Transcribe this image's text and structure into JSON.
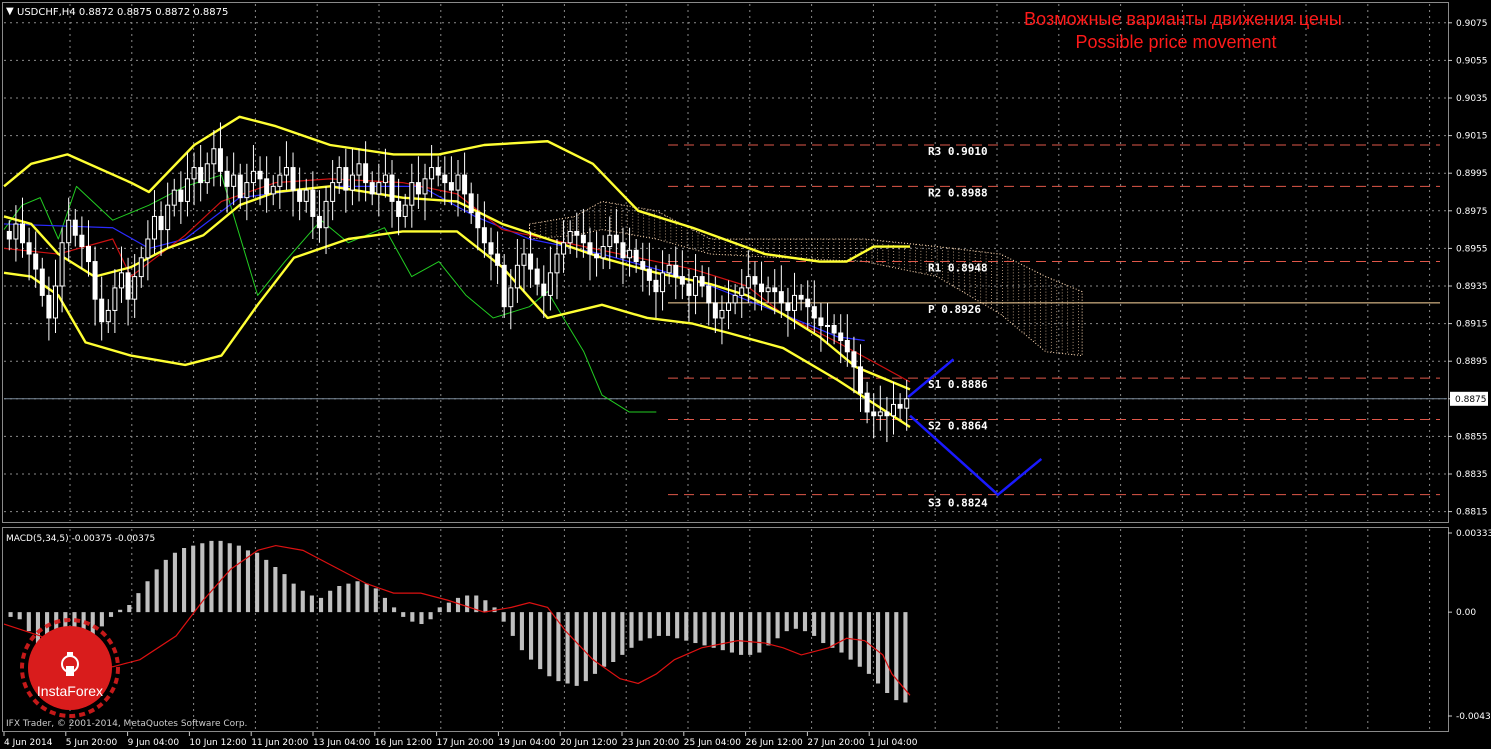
{
  "window": {
    "symbol_info": "USDCHF,H4  0.8872 0.8875 0.8872 0.8875",
    "copyright": "IFX Trader, © 2001-2014, MetaQuotes Software Corp."
  },
  "annotation": {
    "title_ru": "Возможные варианты движения цены",
    "title_en": "Possible price movement",
    "color": "#ff1a1a"
  },
  "logo": {
    "text": "InstaForex",
    "color": "#d91c1c"
  },
  "colors": {
    "bollinger": "#ffff33",
    "candle": "#ffffff",
    "kijun": "#2b2bff",
    "tenkan": "#cc1111",
    "chikou": "#22cc22",
    "cloud": "#ffd9b3",
    "pivot": "#ffd9a0",
    "level": "#e0584a",
    "forecast": "#1a1aff",
    "macd_hist": "#c0c0c0",
    "macd_signal": "#dd1111",
    "grid": "#8a8a8a"
  },
  "chart_data": [
    {
      "type": "candlestick",
      "symbol": "USDCHF",
      "timeframe": "H4",
      "ylim": [
        0.881,
        0.9085
      ],
      "yticks": [
        "0.9075",
        "0.9055",
        "0.9035",
        "0.9015",
        "0.8995",
        "0.8975",
        "0.8955",
        "0.8935",
        "0.8915",
        "0.8895",
        "0.8875",
        "0.8855",
        "0.8835",
        "0.8815"
      ],
      "current_price": "0.8875",
      "xlabels": [
        "4 Jun 2014",
        "5 Jun 20:00",
        "9 Jun 04:00",
        "10 Jun 12:00",
        "11 Jun 20:00",
        "13 Jun 04:00",
        "16 Jun 12:00",
        "17 Jun 20:00",
        "19 Jun 04:00",
        "20 Jun 12:00",
        "23 Jun 20:00",
        "25 Jun 04:00",
        "26 Jun 12:00",
        "27 Jun 20:00",
        "1 Jul 04:00"
      ],
      "levels": [
        {
          "name": "R3",
          "label": "R3 0.9010",
          "value": 0.901,
          "style": "dashed"
        },
        {
          "name": "R2",
          "label": "R2 0.8988",
          "value": 0.8988,
          "style": "dashed"
        },
        {
          "name": "R1",
          "label": "R1 0.8948",
          "value": 0.8948,
          "style": "dashed"
        },
        {
          "name": "P",
          "label": "P 0.8926",
          "value": 0.8926,
          "style": "solid"
        },
        {
          "name": "S1",
          "label": "S1 0.8886",
          "value": 0.8886,
          "style": "dashed"
        },
        {
          "name": "S2",
          "label": "S2 0.8864",
          "value": 0.8864,
          "style": "dashed"
        },
        {
          "name": "S3",
          "label": "S3 0.8824",
          "value": 0.8824,
          "style": "dashed"
        }
      ],
      "closes": [
        0.896,
        0.8968,
        0.8958,
        0.8952,
        0.8944,
        0.893,
        0.8918,
        0.8935,
        0.8958,
        0.897,
        0.8962,
        0.8956,
        0.8948,
        0.8928,
        0.8916,
        0.8922,
        0.8934,
        0.8942,
        0.8928,
        0.894,
        0.895,
        0.896,
        0.8972,
        0.8965,
        0.8978,
        0.8986,
        0.898,
        0.8992,
        0.8998,
        0.899,
        0.9,
        0.9008,
        0.8996,
        0.8988,
        0.8994,
        0.8982,
        0.899,
        0.8996,
        0.8992,
        0.8984,
        0.8988,
        0.8994,
        0.8998,
        0.8986,
        0.898,
        0.8986,
        0.8972,
        0.8966,
        0.898,
        0.899,
        0.8998,
        0.8986,
        0.8994,
        0.9,
        0.899,
        0.8984,
        0.899,
        0.8994,
        0.898,
        0.8972,
        0.8978,
        0.899,
        0.8984,
        0.8992,
        0.8998,
        0.8994,
        0.899,
        0.8986,
        0.8994,
        0.8984,
        0.8974,
        0.8966,
        0.8958,
        0.8952,
        0.8946,
        0.8924,
        0.8934,
        0.8946,
        0.8952,
        0.8944,
        0.8936,
        0.893,
        0.8942,
        0.8952,
        0.8958,
        0.8964,
        0.8962,
        0.8958,
        0.8952,
        0.895,
        0.8956,
        0.8962,
        0.8958,
        0.895,
        0.8954,
        0.8948,
        0.8944,
        0.8938,
        0.8932,
        0.8942,
        0.8946,
        0.894,
        0.8936,
        0.893,
        0.894,
        0.8935,
        0.8926,
        0.8918,
        0.8922,
        0.8926,
        0.893,
        0.8934,
        0.894,
        0.8936,
        0.8932,
        0.8934,
        0.8932,
        0.8926,
        0.8922,
        0.893,
        0.8928,
        0.8924,
        0.8918,
        0.8914,
        0.8914,
        0.891,
        0.8906,
        0.89,
        0.8892,
        0.8878,
        0.8868,
        0.8866,
        0.8868,
        0.8866,
        0.8872,
        0.887,
        0.8875
      ],
      "bb_upper": [
        [
          0.8988,
          0
        ],
        [
          0.9,
          0.03
        ],
        [
          0.9005,
          0.07
        ],
        [
          0.899,
          0.14
        ],
        [
          0.8985,
          0.16
        ],
        [
          0.901,
          0.21
        ],
        [
          0.9025,
          0.26
        ],
        [
          0.902,
          0.3
        ],
        [
          0.901,
          0.36
        ],
        [
          0.9005,
          0.43
        ],
        [
          0.9005,
          0.48
        ],
        [
          0.901,
          0.53
        ],
        [
          0.9012,
          0.6
        ],
        [
          0.9,
          0.65
        ],
        [
          0.8975,
          0.7
        ],
        [
          0.8966,
          0.76
        ],
        [
          0.8952,
          0.84
        ],
        [
          0.8948,
          0.9
        ],
        [
          0.8948,
          0.93
        ],
        [
          0.8956,
          0.96
        ],
        [
          0.8956,
          1
        ]
      ],
      "bb_lower": [
        [
          0.8942,
          0
        ],
        [
          0.894,
          0.03
        ],
        [
          0.893,
          0.06
        ],
        [
          0.8905,
          0.09
        ],
        [
          0.8898,
          0.14
        ],
        [
          0.8893,
          0.2
        ],
        [
          0.8898,
          0.24
        ],
        [
          0.8925,
          0.28
        ],
        [
          0.895,
          0.32
        ],
        [
          0.896,
          0.38
        ],
        [
          0.8964,
          0.44
        ],
        [
          0.8964,
          0.5
        ],
        [
          0.8945,
          0.55
        ],
        [
          0.8918,
          0.6
        ],
        [
          0.8925,
          0.66
        ],
        [
          0.8918,
          0.71
        ],
        [
          0.8915,
          0.76
        ],
        [
          0.891,
          0.8
        ],
        [
          0.8902,
          0.86
        ],
        [
          0.8885,
          0.92
        ],
        [
          0.886,
          1
        ]
      ],
      "bb_middle": [
        [
          0.8972,
          0
        ],
        [
          0.8968,
          0.03
        ],
        [
          0.8952,
          0.06
        ],
        [
          0.894,
          0.1
        ],
        [
          0.8945,
          0.14
        ],
        [
          0.8955,
          0.18
        ],
        [
          0.8962,
          0.22
        ],
        [
          0.8978,
          0.26
        ],
        [
          0.8985,
          0.3
        ],
        [
          0.8988,
          0.36
        ],
        [
          0.8982,
          0.44
        ],
        [
          0.898,
          0.5
        ],
        [
          0.8968,
          0.55
        ],
        [
          0.896,
          0.6
        ],
        [
          0.895,
          0.66
        ],
        [
          0.8942,
          0.72
        ],
        [
          0.8936,
          0.78
        ],
        [
          0.893,
          0.82
        ],
        [
          0.892,
          0.86
        ],
        [
          0.8908,
          0.9
        ],
        [
          0.8892,
          0.94
        ],
        [
          0.888,
          1
        ]
      ],
      "tenkan": [
        [
          0.8955,
          0
        ],
        [
          0.8952,
          0.06
        ],
        [
          0.896,
          0.12
        ],
        [
          0.894,
          0.14
        ],
        [
          0.8962,
          0.2
        ],
        [
          0.898,
          0.24
        ],
        [
          0.899,
          0.3
        ],
        [
          0.8992,
          0.36
        ],
        [
          0.899,
          0.44
        ],
        [
          0.8984,
          0.5
        ],
        [
          0.8965,
          0.55
        ],
        [
          0.8958,
          0.62
        ],
        [
          0.895,
          0.7
        ],
        [
          0.8944,
          0.76
        ],
        [
          0.8935,
          0.82
        ],
        [
          0.892,
          0.86
        ],
        [
          0.8905,
          0.92
        ],
        [
          0.8884,
          1
        ]
      ],
      "kijun": [
        [
          0.8968,
          0
        ],
        [
          0.8966,
          0.12
        ],
        [
          0.8955,
          0.16
        ],
        [
          0.896,
          0.2
        ],
        [
          0.8982,
          0.26
        ],
        [
          0.8988,
          0.36
        ],
        [
          0.8988,
          0.46
        ],
        [
          0.8972,
          0.52
        ],
        [
          0.896,
          0.58
        ],
        [
          0.8952,
          0.66
        ],
        [
          0.8944,
          0.72
        ],
        [
          0.8935,
          0.78
        ],
        [
          0.892,
          0.86
        ],
        [
          0.8908,
          0.92
        ],
        [
          0.8906,
          0.95
        ]
      ],
      "chikou": [
        [
          0.8965,
          0
        ],
        [
          0.8978,
          0.02
        ],
        [
          0.8982,
          0.04
        ],
        [
          0.896,
          0.06
        ],
        [
          0.8988,
          0.08
        ],
        [
          0.897,
          0.12
        ],
        [
          0.8978,
          0.16
        ],
        [
          0.8988,
          0.2
        ],
        [
          0.8994,
          0.24
        ],
        [
          0.893,
          0.28
        ],
        [
          0.8948,
          0.31
        ],
        [
          0.897,
          0.35
        ],
        [
          0.8958,
          0.38
        ],
        [
          0.8966,
          0.42
        ],
        [
          0.894,
          0.45
        ],
        [
          0.8948,
          0.48
        ],
        [
          0.893,
          0.51
        ],
        [
          0.8918,
          0.54
        ],
        [
          0.8924,
          0.58
        ],
        [
          0.8932,
          0.6
        ],
        [
          0.8916,
          0.62
        ],
        [
          0.89,
          0.64
        ],
        [
          0.8877,
          0.66
        ],
        [
          0.8868,
          0.69
        ],
        [
          0.8868,
          0.72
        ]
      ],
      "macd": {
        "label": "MACD(5,34,5) -0.00375 -0.00375",
        "ylim": [
          -0.00437,
          0.00333
        ],
        "yticks": [
          "0.00333",
          "0.00",
          "-0.00437"
        ],
        "hist": [
          -0.0002,
          -0.0003,
          -0.0008,
          -0.0014,
          -0.0019,
          -0.0022,
          -0.0021,
          -0.0018,
          -0.0015,
          -0.001,
          -0.0006,
          -0.0002,
          0.0001,
          0.0003,
          0.0008,
          0.0013,
          0.0018,
          0.0022,
          0.0025,
          0.0027,
          0.0028,
          0.0029,
          0.003,
          0.003,
          0.0029,
          0.0028,
          0.0026,
          0.0025,
          0.0022,
          0.0019,
          0.0016,
          0.0012,
          0.0009,
          0.0007,
          0.0006,
          0.0009,
          0.0011,
          0.0012,
          0.0013,
          0.0012,
          0.001,
          0.0006,
          0.0002,
          -0.0002,
          -0.0004,
          -0.0005,
          -0.0003,
          0.0002,
          0.0004,
          0.0006,
          0.0007,
          0.0007,
          0.0005,
          0.0002,
          -0.0004,
          -0.001,
          -0.0016,
          -0.002,
          -0.0024,
          -0.0027,
          -0.0029,
          -0.003,
          -0.0031,
          -0.0029,
          -0.0026,
          -0.0023,
          -0.0021,
          -0.0018,
          -0.0015,
          -0.0012,
          -0.0011,
          -0.001,
          -0.001,
          -0.0011,
          -0.0012,
          -0.0013,
          -0.0014,
          -0.0015,
          -0.0016,
          -0.0017,
          -0.0018,
          -0.0018,
          -0.0017,
          -0.0014,
          -0.0011,
          -0.0008,
          -0.0007,
          -0.0008,
          -0.001,
          -0.0013,
          -0.0015,
          -0.0017,
          -0.002,
          -0.0023,
          -0.0026,
          -0.003,
          -0.0034,
          -0.0037,
          -0.0038
        ],
        "signal": [
          [
            -0.0005,
            0
          ],
          [
            -0.001,
            0.04
          ],
          [
            -0.0016,
            0.07
          ],
          [
            -0.0021,
            0.1
          ],
          [
            -0.0023,
            0.12
          ],
          [
            -0.002,
            0.15
          ],
          [
            -0.001,
            0.19
          ],
          [
            0.0005,
            0.22
          ],
          [
            0.0018,
            0.25
          ],
          [
            0.0026,
            0.28
          ],
          [
            0.0028,
            0.3
          ],
          [
            0.0026,
            0.33
          ],
          [
            0.002,
            0.36
          ],
          [
            0.0012,
            0.4
          ],
          [
            0.0008,
            0.43
          ],
          [
            0.0008,
            0.46
          ],
          [
            0.0005,
            0.49
          ],
          [
            0.0,
            0.53
          ],
          [
            0.0002,
            0.56
          ],
          [
            0.0004,
            0.58
          ],
          [
            0.0002,
            0.6
          ],
          [
            -0.0008,
            0.62
          ],
          [
            -0.002,
            0.65
          ],
          [
            -0.0028,
            0.68
          ],
          [
            -0.003,
            0.7
          ],
          [
            -0.0026,
            0.72
          ],
          [
            -0.002,
            0.74
          ],
          [
            -0.0015,
            0.77
          ],
          [
            -0.0012,
            0.81
          ],
          [
            -0.0013,
            0.84
          ],
          [
            -0.0015,
            0.86
          ],
          [
            -0.0018,
            0.88
          ],
          [
            -0.0015,
            0.91
          ],
          [
            -0.0011,
            0.93
          ],
          [
            -0.0012,
            0.95
          ],
          [
            -0.0018,
            0.97
          ],
          [
            -0.0026,
            0.98
          ],
          [
            -0.0035,
            1
          ]
        ]
      }
    }
  ]
}
